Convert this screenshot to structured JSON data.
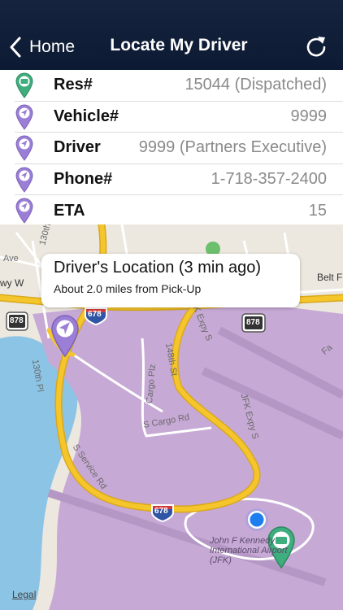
{
  "nav": {
    "back_label": "Home",
    "title": "Locate My Driver",
    "back_icon": "chevron-left-icon",
    "refresh_icon": "refresh-icon"
  },
  "info": [
    {
      "label": "Res#",
      "value": "15044 (Dispatched)",
      "icon": "dispatch-pin-icon"
    },
    {
      "label": "Vehicle#",
      "value": "9999",
      "icon": "location-pin-icon"
    },
    {
      "label": "Driver",
      "value": "9999 (Partners Executive)",
      "icon": "location-pin-icon"
    },
    {
      "label": "Phone#",
      "value": "1-718-357-2400",
      "icon": "location-pin-icon"
    },
    {
      "label": "ETA",
      "value": "15",
      "icon": "location-pin-icon"
    }
  ],
  "map": {
    "callout_title": "Driver's Location (3 min ago)",
    "callout_subtitle": "About 2.0 miles from Pick-Up",
    "legal": "Legal",
    "labels": {
      "street_130th": "130th",
      "ave": "Ave",
      "pkwy_w": "wy W",
      "belt": "Belt F",
      "cargo_plz": "Cargo Plz",
      "s_cargo_rd": "S Cargo Rd",
      "jfk_expy_s": "JFK Expy S",
      "st_148th": "148th St",
      "pl_130th": "130th Pl",
      "s_service_rd": "S Service Rd",
      "fa": "Fa",
      "airport": "John F Kennedy International Airport (JFK)",
      "shield_878_left": "878",
      "shield_878_right": "878",
      "shield_678_top": "678",
      "shield_678_bottom": "678"
    }
  },
  "colors": {
    "navbar": "#0d1a33",
    "pin_purple": "#9b7fd6",
    "pin_green": "#3fae7e",
    "airport_purple": "#c7a9d6",
    "highway_yellow": "#f5c62c",
    "water_blue": "#8cc4e6",
    "user_dot": "#1e7ef0"
  }
}
